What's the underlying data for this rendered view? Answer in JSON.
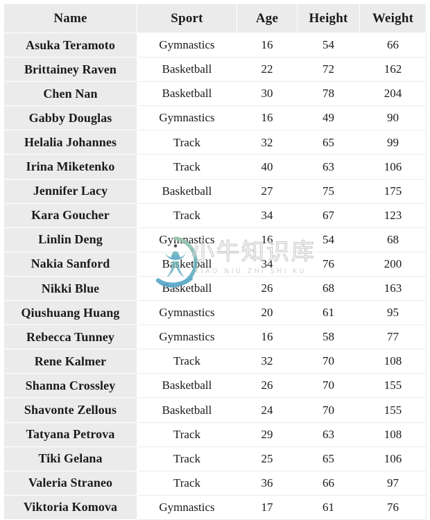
{
  "table": {
    "columns": [
      "Name",
      "Sport",
      "Age",
      "Height",
      "Weight"
    ],
    "rows": [
      {
        "name": "Asuka Teramoto",
        "sport": "Gymnastics",
        "age": "16",
        "height": "54",
        "weight": "66"
      },
      {
        "name": "Brittainey Raven",
        "sport": "Basketball",
        "age": "22",
        "height": "72",
        "weight": "162"
      },
      {
        "name": "Chen Nan",
        "sport": "Basketball",
        "age": "30",
        "height": "78",
        "weight": "204"
      },
      {
        "name": "Gabby Douglas",
        "sport": "Gymnastics",
        "age": "16",
        "height": "49",
        "weight": "90"
      },
      {
        "name": "Helalia Johannes",
        "sport": "Track",
        "age": "32",
        "height": "65",
        "weight": "99"
      },
      {
        "name": "Irina Miketenko",
        "sport": "Track",
        "age": "40",
        "height": "63",
        "weight": "106"
      },
      {
        "name": "Jennifer Lacy",
        "sport": "Basketball",
        "age": "27",
        "height": "75",
        "weight": "175"
      },
      {
        "name": "Kara Goucher",
        "sport": "Track",
        "age": "34",
        "height": "67",
        "weight": "123"
      },
      {
        "name": "Linlin Deng",
        "sport": "Gymnastics",
        "age": "16",
        "height": "54",
        "weight": "68"
      },
      {
        "name": "Nakia Sanford",
        "sport": "Basketball",
        "age": "34",
        "height": "76",
        "weight": "200"
      },
      {
        "name": "Nikki Blue",
        "sport": "Basketball",
        "age": "26",
        "height": "68",
        "weight": "163"
      },
      {
        "name": "Qiushuang Huang",
        "sport": "Gymnastics",
        "age": "20",
        "height": "61",
        "weight": "95"
      },
      {
        "name": "Rebecca Tunney",
        "sport": "Gymnastics",
        "age": "16",
        "height": "58",
        "weight": "77"
      },
      {
        "name": "Rene Kalmer",
        "sport": "Track",
        "age": "32",
        "height": "70",
        "weight": "108"
      },
      {
        "name": "Shanna Crossley",
        "sport": "Basketball",
        "age": "26",
        "height": "70",
        "weight": "155"
      },
      {
        "name": "Shavonte Zellous",
        "sport": "Basketball",
        "age": "24",
        "height": "70",
        "weight": "155"
      },
      {
        "name": "Tatyana Petrova",
        "sport": "Track",
        "age": "29",
        "height": "63",
        "weight": "108"
      },
      {
        "name": "Tiki Gelana",
        "sport": "Track",
        "age": "25",
        "height": "65",
        "weight": "106"
      },
      {
        "name": "Valeria Straneo",
        "sport": "Track",
        "age": "36",
        "height": "66",
        "weight": "97"
      },
      {
        "name": "Viktoria Komova",
        "sport": "Gymnastics",
        "age": "17",
        "height": "61",
        "weight": "76"
      }
    ]
  },
  "watermark": {
    "chinese_text": "小牛知识库",
    "pinyin_text": "XIAO NIU ZHI SHI KU",
    "logo_icon": "bull-head-circle-logo",
    "ring_color_top": "#8fc2a0",
    "ring_color_bottom": "#5aa7c4"
  },
  "colors": {
    "header_background": "#ebebeb",
    "name_column_background": "#ebebeb",
    "cell_background": "#ffffff",
    "text": "#1a1a1a",
    "gridline": "#ececec"
  }
}
